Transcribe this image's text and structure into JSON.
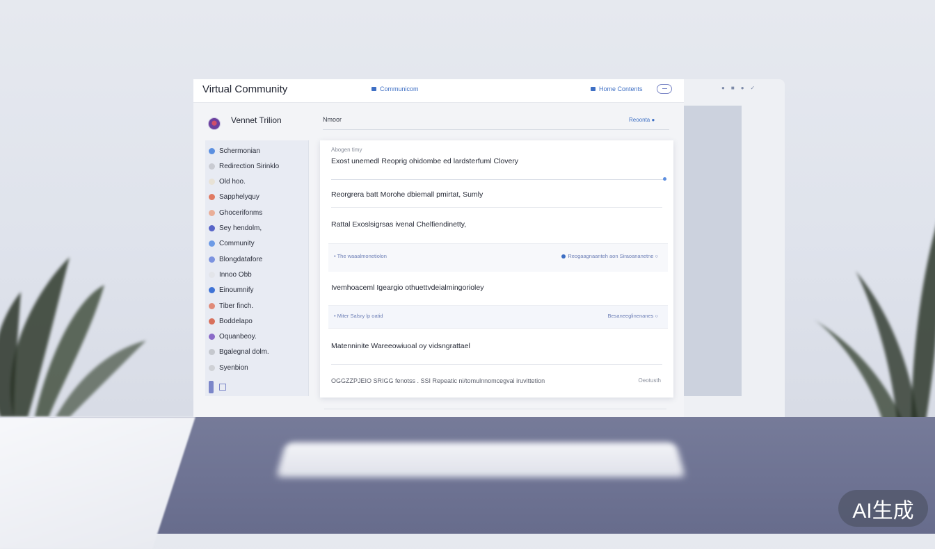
{
  "header": {
    "app_title": "Virtual Community",
    "center_link": "Communicom",
    "right_link": "Home Contents"
  },
  "profile": {
    "name": "Vennet Trilion"
  },
  "sidebar": {
    "items": [
      {
        "label": "Schermonian",
        "color": "#5b8fe0"
      },
      {
        "label": "Redirection Sirinklo",
        "color": "#c9cbd2"
      },
      {
        "label": "Old hoo.",
        "color": "#e8e2d6"
      },
      {
        "label": "Sapphelyquy",
        "color": "#e07a62"
      },
      {
        "label": "Ghocerifonms",
        "color": "#e9ae98"
      },
      {
        "label": "Sey hendolm,",
        "color": "#5865c8"
      },
      {
        "label": "Community",
        "color": "#6d9be6"
      },
      {
        "label": "Blongdatafore",
        "color": "#7c93e0"
      },
      {
        "label": "Innoo Obb",
        "color": "#e3e5ea"
      },
      {
        "label": "Einoumnify",
        "color": "#3f73d6"
      },
      {
        "label": "Tiber finch.",
        "color": "#e08a78"
      },
      {
        "label": "Boddelapo",
        "color": "#d8705c"
      },
      {
        "label": "Oquanbeoy.",
        "color": "#8a6ac8"
      },
      {
        "label": "Bgalegnal dolm.",
        "color": "#c5c8ce"
      },
      {
        "label": "Syenbion",
        "color": "#cfd1d6"
      }
    ]
  },
  "panel": {
    "section_label": "Nmoor",
    "section_link": "Reoonta",
    "meta": "Abogen timy",
    "rows": [
      "Exost unemedl Reoprig ohidombe ed lardsterfuml Clovery",
      "Reorgrera batt Morohe dbiemall pmirtat, Sumly",
      "Rattal Exoslsigrsas ivenal Chelfiendinetty,",
      "Ivemhoaceml Igeargio othuettvdeialmingorioley",
      "Matenninite Wareeowiuoal oy vidsngrattael"
    ],
    "strip1": {
      "left": "The waaalmonetiolon",
      "right": "Reogaagnaanteh aon Siraoananetne"
    },
    "strip2": {
      "left": "Miter Salsry lp oatid",
      "right": "Besaneeglinenanes"
    },
    "footer_text": "OGGZZPJEIO SRIGG fenotss . SSI Repeatic ni/tomulnnomcegvai iruvittetion",
    "footer_link": "Oeotusth"
  },
  "watermark": "AI生成"
}
